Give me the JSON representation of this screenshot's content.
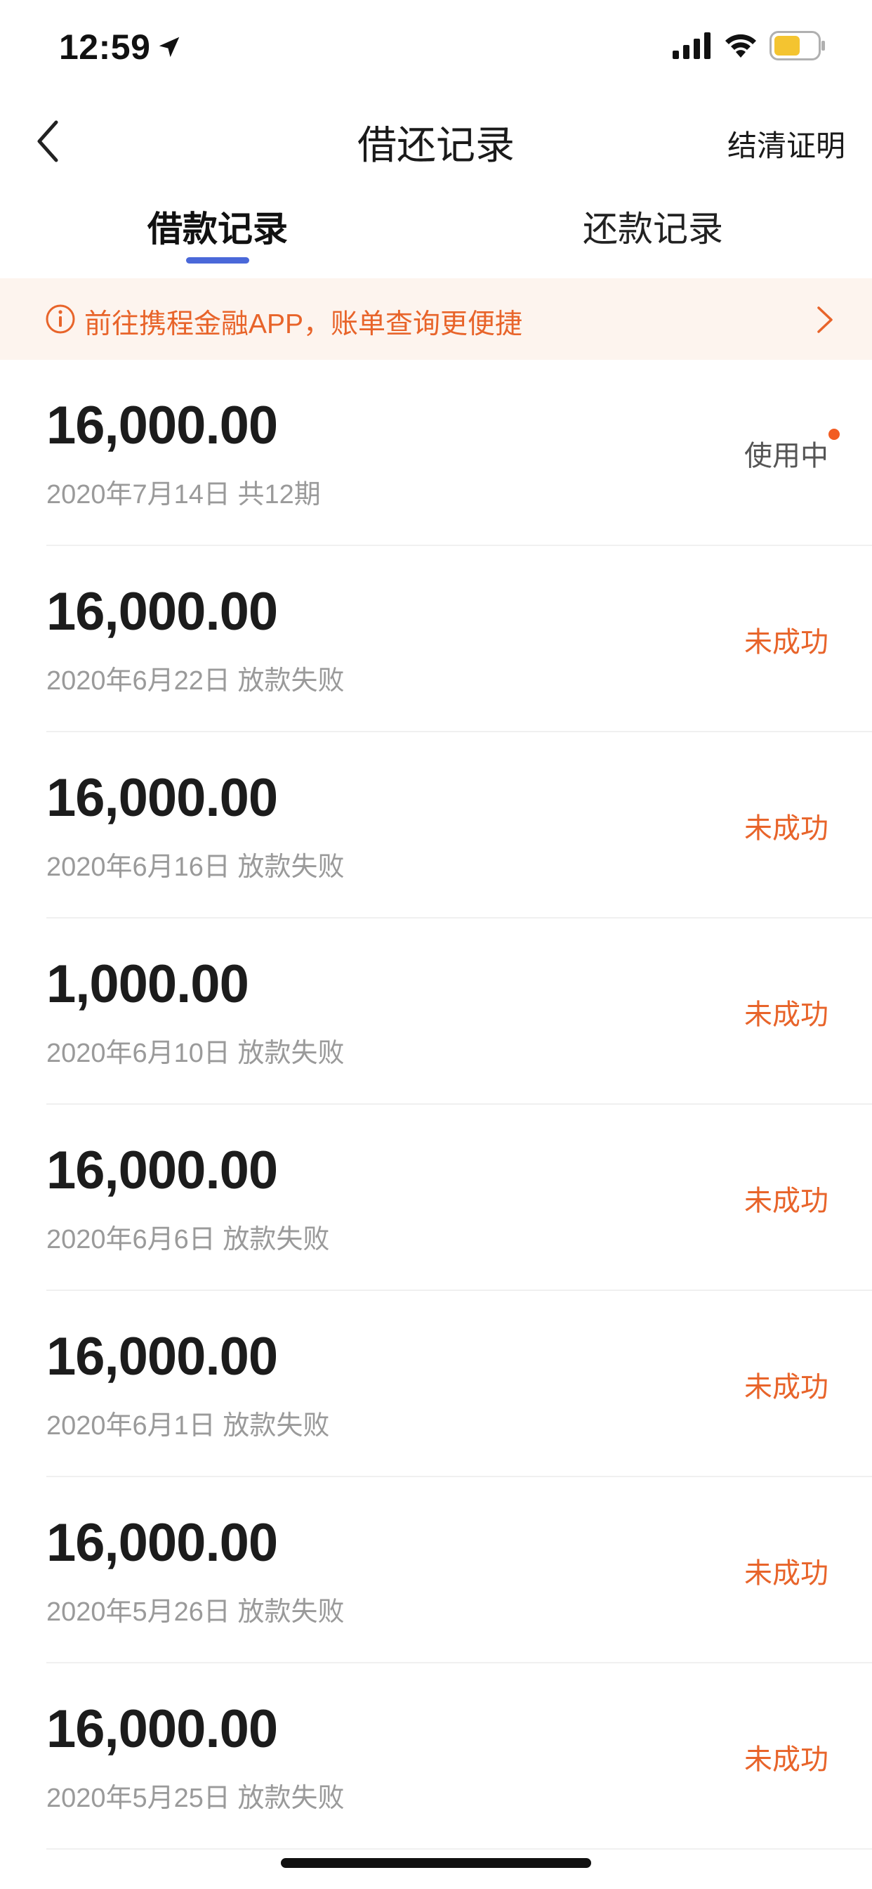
{
  "status_bar": {
    "time": "12:59",
    "icons": [
      "location-arrow-icon",
      "cellular-signal-icon",
      "wifi-icon",
      "battery-icon"
    ],
    "battery_color": "#f4c430"
  },
  "nav": {
    "title": "借还记录",
    "right_action": "结清证明",
    "back_icon": "chevron-left-icon"
  },
  "tabs": [
    {
      "label": "借款记录",
      "active": true
    },
    {
      "label": "还款记录",
      "active": false
    }
  ],
  "accent_color": "#4a68d9",
  "banner": {
    "text": "前往携程金融APP，账单查询更便捷",
    "icon": "info-circle-icon",
    "color": "#e8642a"
  },
  "records": [
    {
      "amount": "16,000.00",
      "subtitle": "2020年7月14日 共12期",
      "status": "使用中",
      "status_type": "in-use"
    },
    {
      "amount": "16,000.00",
      "subtitle": "2020年6月22日 放款失败",
      "status": "未成功",
      "status_type": "failed"
    },
    {
      "amount": "16,000.00",
      "subtitle": "2020年6月16日 放款失败",
      "status": "未成功",
      "status_type": "failed"
    },
    {
      "amount": "1,000.00",
      "subtitle": "2020年6月10日 放款失败",
      "status": "未成功",
      "status_type": "failed"
    },
    {
      "amount": "16,000.00",
      "subtitle": "2020年6月6日 放款失败",
      "status": "未成功",
      "status_type": "failed"
    },
    {
      "amount": "16,000.00",
      "subtitle": "2020年6月1日 放款失败",
      "status": "未成功",
      "status_type": "failed"
    },
    {
      "amount": "16,000.00",
      "subtitle": "2020年5月26日 放款失败",
      "status": "未成功",
      "status_type": "failed"
    },
    {
      "amount": "16,000.00",
      "subtitle": "2020年5月25日 放款失败",
      "status": "未成功",
      "status_type": "failed"
    }
  ]
}
